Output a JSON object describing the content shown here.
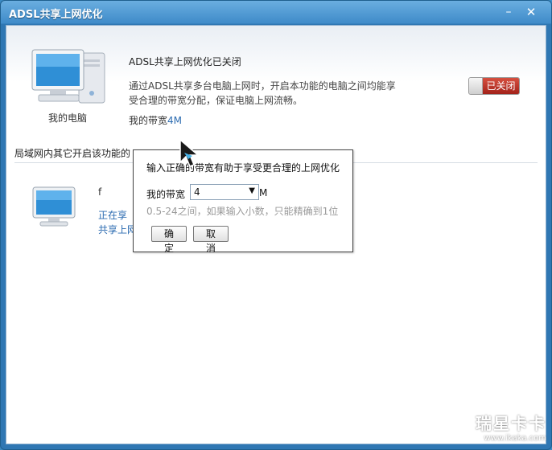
{
  "window": {
    "title": "ADSL共享上网优化",
    "minimize_glyph": "–",
    "close_glyph": "✕"
  },
  "top": {
    "pc_label": "我的电脑",
    "status_title": "ADSL共享上网优化已关闭",
    "description": "通过ADSL共享多台电脑上网时，开启本功能的电脑之间均能享受合理的带宽分配，保证电脑上网流畅。",
    "bandwidth_label": "我的带宽",
    "bandwidth_value": "4M",
    "toggle_state": "已关闭"
  },
  "section": {
    "label": "局域网内其它开启该功能的"
  },
  "list": {
    "items": [
      {
        "name": "f",
        "status1": "正在享",
        "status2": "共享上网优化"
      }
    ]
  },
  "popup": {
    "title": "输入正确的带宽有助于享受更合理的上网优化",
    "bandwidth_label": "我的带宽",
    "select_value": "4",
    "unit": "M",
    "hint": "0.5-24之间，如果输入小数，只能精确到1位",
    "ok_label": "确定",
    "cancel_label": "取消"
  },
  "watermark": {
    "brand": "瑞星卡卡",
    "url": "www.ikaka.com"
  },
  "colors": {
    "titlebar": "#3f8bc9",
    "toggle_off": "#b52d22",
    "link": "#2a6ab0"
  }
}
